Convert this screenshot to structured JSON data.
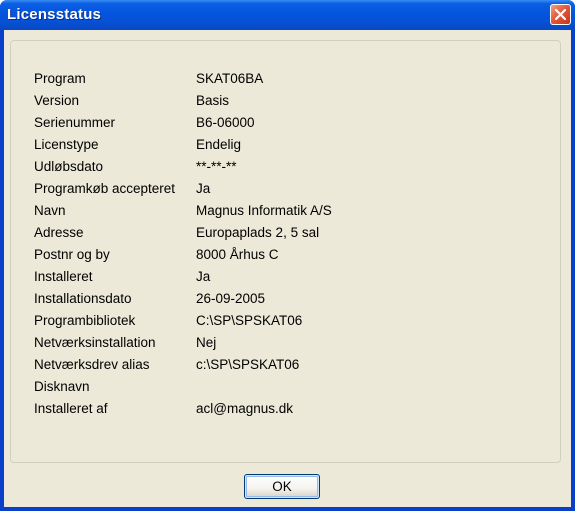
{
  "window": {
    "title": "Licensstatus"
  },
  "info_rows": [
    {
      "label": "Program",
      "value": "SKAT06BA"
    },
    {
      "label": "Version",
      "value": "Basis"
    },
    {
      "label": "Serienummer",
      "value": "B6-06000"
    },
    {
      "label": "Licenstype",
      "value": "Endelig"
    },
    {
      "label": "Udløbsdato",
      "value": "**-**-**"
    },
    {
      "label": "Programkøb accepteret",
      "value": "Ja"
    },
    {
      "label": "Navn",
      "value": "Magnus Informatik A/S"
    },
    {
      "label": "Adresse",
      "value": "Europaplads 2, 5 sal"
    },
    {
      "label": "Postnr og by",
      "value": "8000 Århus C"
    },
    {
      "label": "Installeret",
      "value": "Ja"
    },
    {
      "label": "Installationsdato",
      "value": "26-09-2005"
    },
    {
      "label": "Programbibliotek",
      "value": "C:\\SP\\SPSKAT06"
    },
    {
      "label": "Netværksinstallation",
      "value": "Nej"
    },
    {
      "label": "Netværksdrev alias",
      "value": "c:\\SP\\SPSKAT06"
    },
    {
      "label": "Disknavn",
      "value": ""
    },
    {
      "label": "Installeret af",
      "value": "acl@magnus.dk"
    }
  ],
  "buttons": {
    "ok_label": "OK",
    "close_icon": "close-icon"
  },
  "colors": {
    "titlebar": "#0554dd",
    "close_button": "#e2593c",
    "dialog_background": "#ece9d8"
  }
}
